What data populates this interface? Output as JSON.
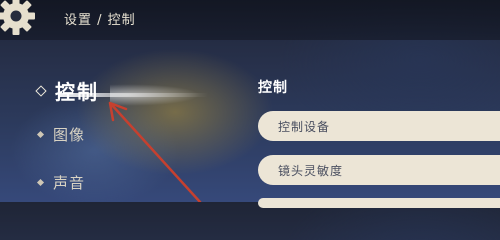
{
  "header": {
    "breadcrumb": "设置 / 控制",
    "gear_icon": "gear-icon"
  },
  "sidebar": {
    "items": [
      {
        "label": "控制",
        "active": true,
        "icon": "diamond-outline-icon"
      },
      {
        "label": "图像",
        "active": false,
        "icon": "diamond-dot-icon"
      },
      {
        "label": "声音",
        "active": false,
        "icon": "diamond-dot-icon"
      }
    ]
  },
  "main": {
    "section_title": "控制",
    "options": [
      {
        "label": "控制设备"
      },
      {
        "label": "镜头灵敏度"
      }
    ]
  },
  "annotation": {
    "arrow_color": "#c6402f",
    "icon": "red-arrow-annotation"
  },
  "colors": {
    "option_background": "#ece5d6",
    "option_text": "#4a4f60",
    "header_text": "#e8e2d2"
  }
}
